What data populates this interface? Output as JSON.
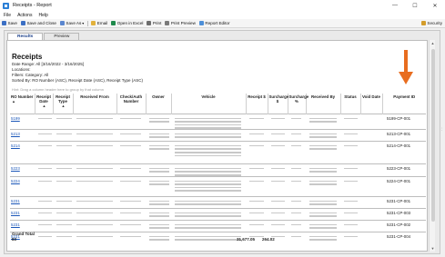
{
  "window": {
    "title": "Receipts - Report",
    "controls": [
      "—",
      "☐",
      "✕"
    ]
  },
  "menu": [
    "File",
    "Actions",
    "Help"
  ],
  "toolbar": {
    "save": "Save",
    "save_close": "Save and Close",
    "save_as": "Save As",
    "email": "Email",
    "open_excel": "Open in Excel",
    "print": "Print",
    "print_preview": "Print Preview",
    "report_editor": "Report Editor",
    "security": "Security"
  },
  "tabs": [
    "Results",
    "Preview"
  ],
  "report": {
    "title": "Receipts",
    "date_range": "Date Range: All [3/16/2022 - 3/16/2025]",
    "locations": "Locations:",
    "filters": "Filters: Category: All",
    "sorted_by": "Sorted By: RO Number (ASC), Receipt Date (ASC), Receipt Type (ASC)",
    "drag_hint": "Hint: Drag a column header here to group by that column"
  },
  "columns": [
    "RO Number",
    "Receipt Date",
    "Receipt Type",
    "Received From",
    "Check/Auth Number",
    "Owner",
    "Vehicle",
    "Receipt $",
    "Surcharge $",
    "Surcharge %",
    "Received By",
    "Status",
    "Void Date",
    "Payment ID"
  ],
  "rows": [
    {
      "ro": "5199",
      "pid": "5199-CP-001",
      "lines": 4
    },
    {
      "ro": "5213",
      "pid": "5213-CP-001",
      "lines": 2
    },
    {
      "ro": "5214",
      "pid": "5214-CP-001",
      "lines": 4
    },
    {
      "ro": "5223",
      "pid": "5223-CP-001",
      "lines": 3
    },
    {
      "ro": "5224",
      "pid": "5224-CP-001",
      "lines": 4
    },
    {
      "ro": "5231",
      "pid": "5231-CP-001",
      "lines": 2
    },
    {
      "ro": "5231",
      "pid": "5231-CP-003",
      "lines": 2
    },
    {
      "ro": "5231",
      "pid": "5231-CP-002",
      "lines": 2
    },
    {
      "ro": "5231",
      "pid": "5231-CP-004",
      "lines": 2
    }
  ],
  "totals": {
    "label": "Grand Total",
    "count": "83",
    "receipt_total": "31,677.05",
    "surcharge_total": "264.02"
  },
  "colors": {
    "accent": "#2b7fd6",
    "link": "#1a56b8",
    "arrow": "#e86d1f"
  }
}
